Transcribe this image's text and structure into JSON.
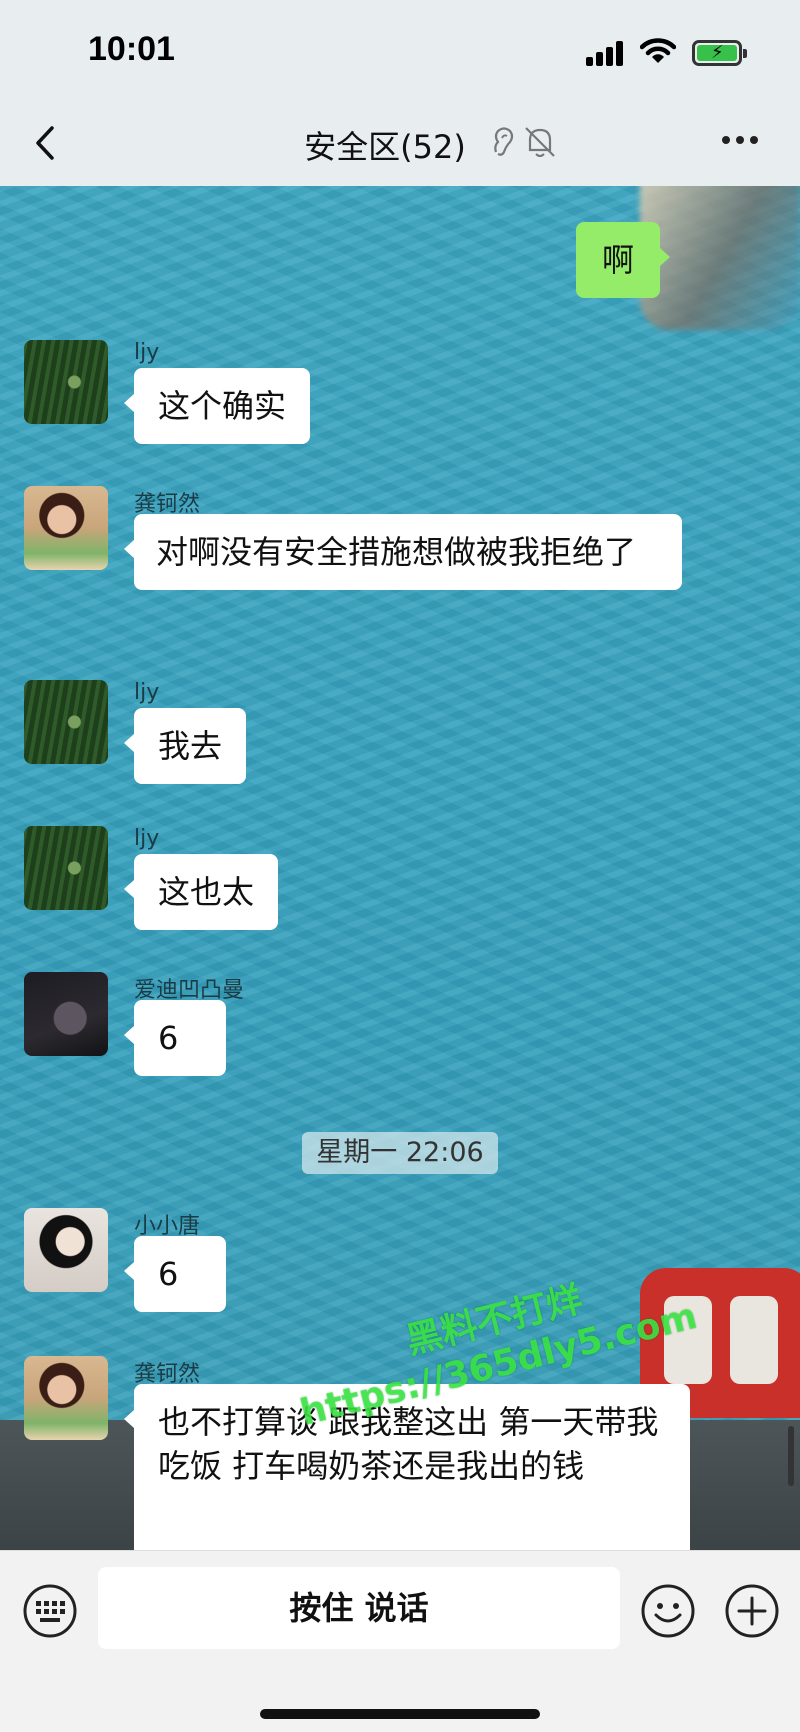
{
  "status_bar": {
    "time": "10:01"
  },
  "nav": {
    "title": "安全区",
    "member_count": "(52)",
    "icons": [
      "back-chevron-icon",
      "ear-icon",
      "mute-bell-icon",
      "more-dots-icon"
    ]
  },
  "messages": [
    {
      "side": "right",
      "text": "啊"
    },
    {
      "side": "left",
      "sender": "ljy",
      "text": "这个确实"
    },
    {
      "side": "left",
      "sender": "龚钶然",
      "text": "对啊没有安全措施想做被我拒绝了"
    },
    {
      "side": "left",
      "sender": "ljy",
      "text": "我去"
    },
    {
      "side": "left",
      "sender": "ljy",
      "text": "这也太"
    },
    {
      "side": "left",
      "sender": "爱迪凹凸曼",
      "text": "6"
    },
    {
      "side": "left",
      "sender": "小小唐",
      "text": "6"
    },
    {
      "side": "left",
      "sender": "龚钶然",
      "text": "也不打算谈 跟我整这出 第一天带我吃饭 打车喝奶茶还是我出的钱"
    }
  ],
  "timestamp": "星期一 22:06",
  "watermark": {
    "line1": "黑料不打烊",
    "line2": "https://365dly5.com"
  },
  "input_bar": {
    "voice_label": "按住 说话",
    "icons": [
      "keyboard-icon",
      "emoji-icon",
      "plus-icon"
    ]
  },
  "colors": {
    "own_bubble": "#95ec69",
    "other_bubble": "#ffffff",
    "chat_background": "#3aa3bf",
    "header_bg": "#e8eef0"
  }
}
